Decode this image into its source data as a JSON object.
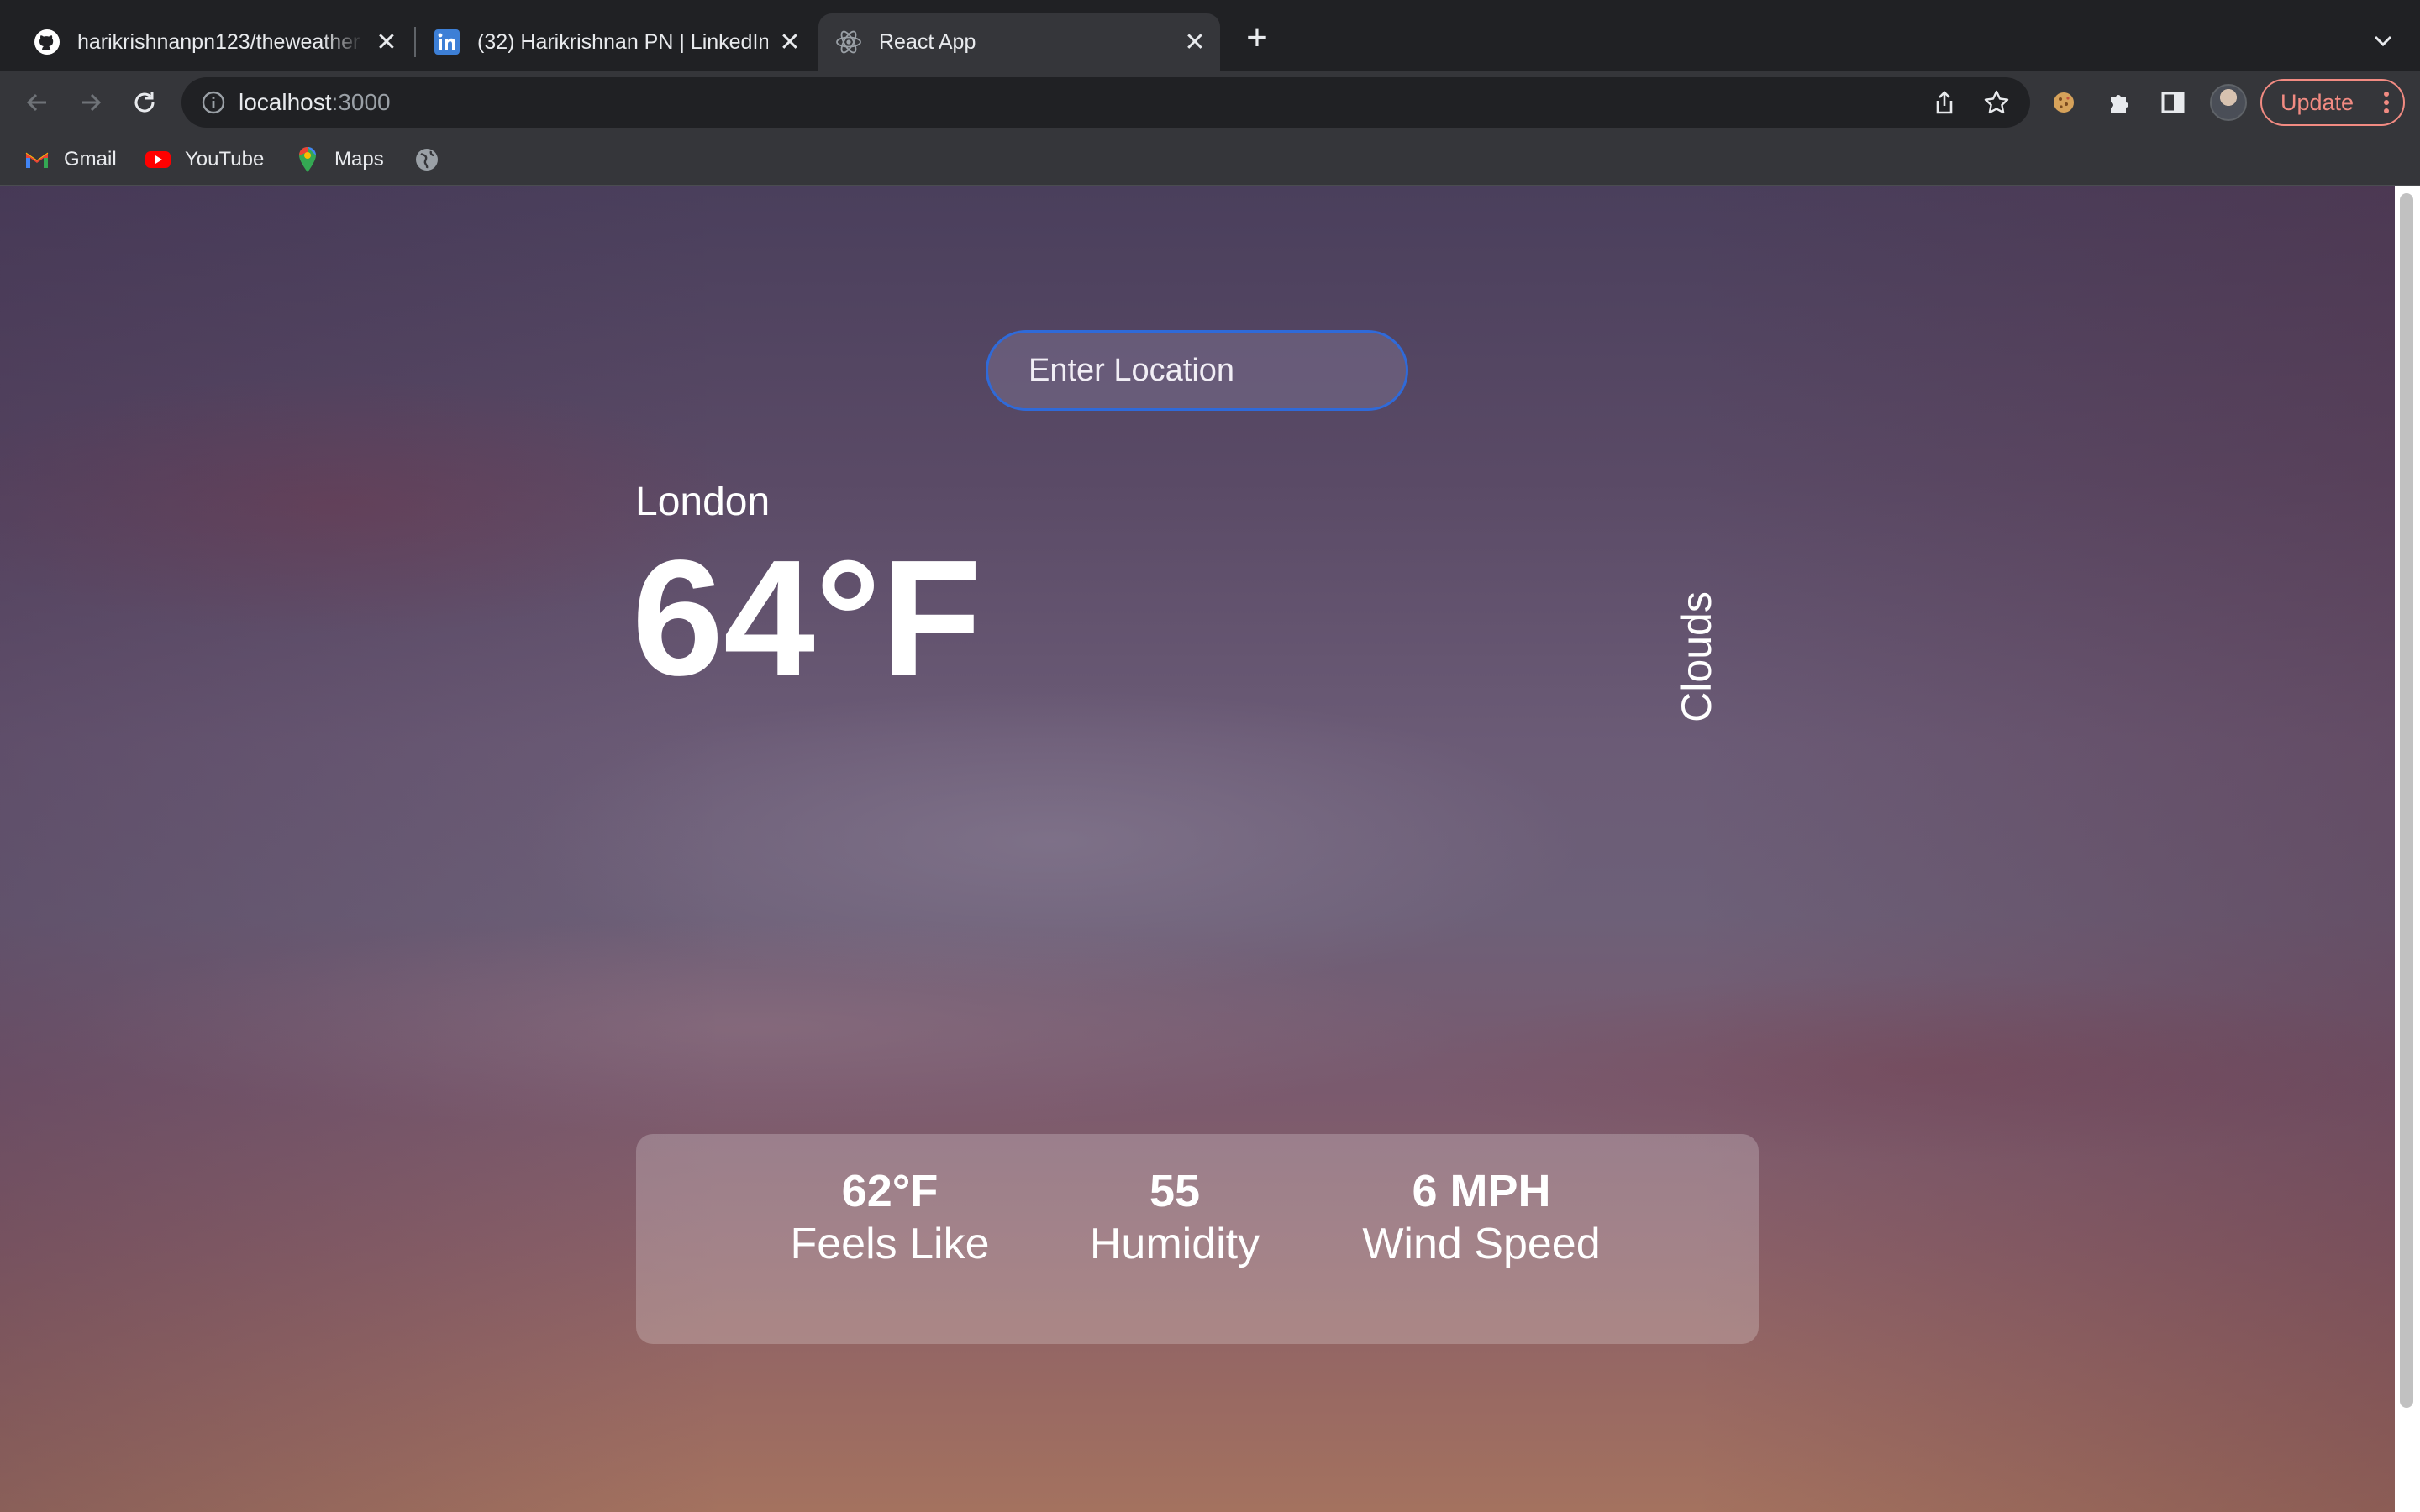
{
  "browser": {
    "tabs": [
      {
        "title": "harikrishnanpn123/theweather",
        "favicon": "github-icon",
        "active": false
      },
      {
        "title": "(32) Harikrishnan PN | LinkedIn",
        "favicon": "linkedin-icon",
        "active": false
      },
      {
        "title": "React App",
        "favicon": "react-icon",
        "active": true
      }
    ],
    "address": {
      "host": "localhost",
      "port": ":3000"
    },
    "update_label": "Update",
    "bookmarks": [
      {
        "label": "Gmail",
        "icon": "gmail-icon"
      },
      {
        "label": "YouTube",
        "icon": "youtube-icon"
      },
      {
        "label": "Maps",
        "icon": "maps-icon"
      }
    ],
    "colors": {
      "frame": "#202124",
      "toolbar": "#35363a",
      "update_accent": "#f28b82"
    }
  },
  "weather": {
    "search_placeholder": "Enter Location",
    "location": "London",
    "temperature": "64°F",
    "description": "Clouds",
    "stats": [
      {
        "value": "62°F",
        "label": "Feels Like"
      },
      {
        "value": "55",
        "label": "Humidity"
      },
      {
        "value": "6 MPH",
        "label": "Wind Speed"
      }
    ],
    "colors": {
      "input_border": "#2f6ad9",
      "text": "#ffffff"
    }
  }
}
